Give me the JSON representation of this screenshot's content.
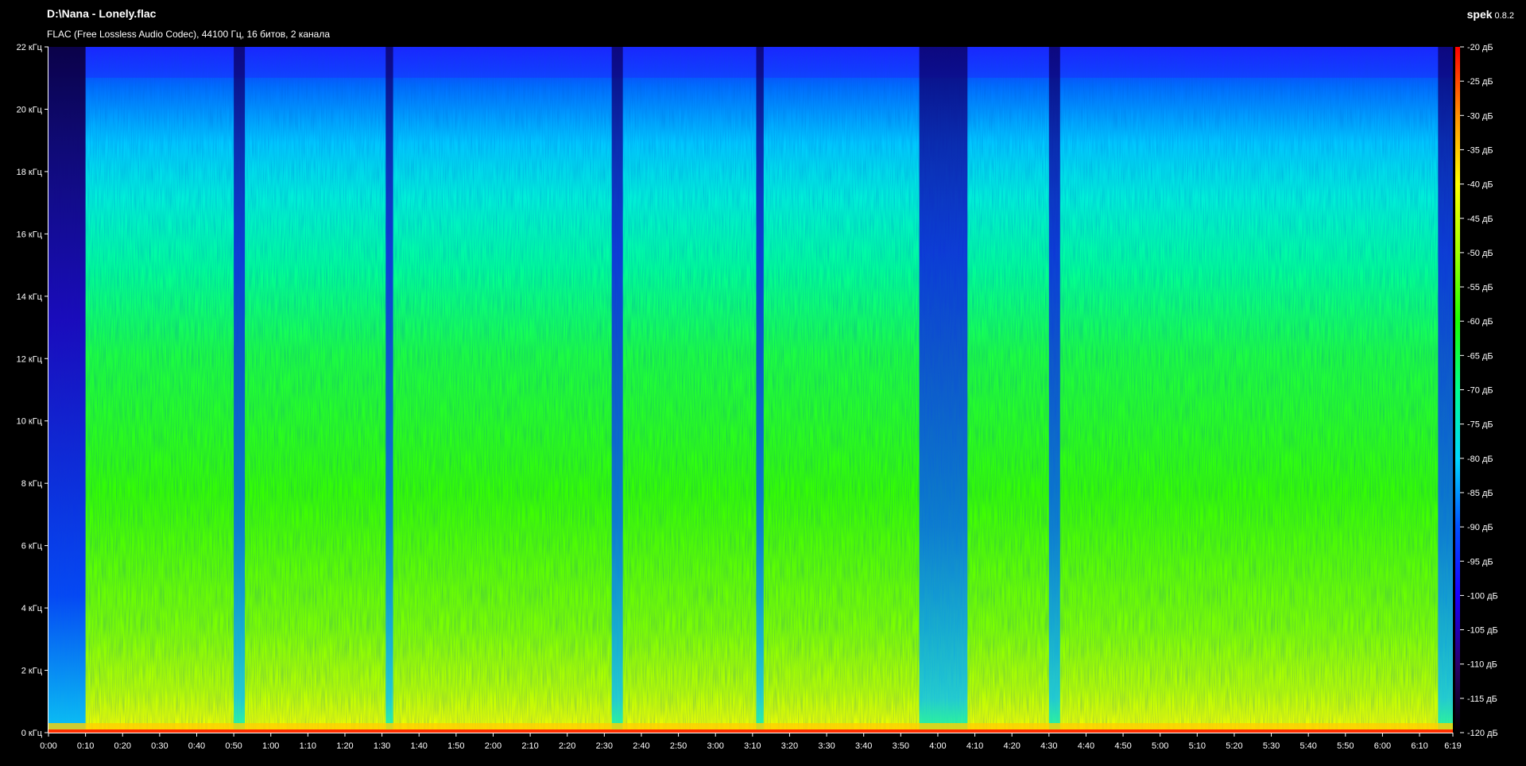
{
  "header": {
    "file_title": "D:\\Nana - Lonely.flac",
    "file_info": "FLAC (Free Lossless Audio Codec), 44100 Гц, 16 битов, 2 канала",
    "app_name": "spek",
    "app_version": "0.8.2"
  },
  "chart_data": {
    "type": "heatmap",
    "subtype": "spectrogram",
    "title": "D:\\Nana - Lonely.flac",
    "y_axis": {
      "unit": "кГц",
      "range": [
        0,
        22
      ],
      "ticks": [
        {
          "value": 0,
          "label": "0 кГц"
        },
        {
          "value": 2,
          "label": "2 кГц"
        },
        {
          "value": 4,
          "label": "4 кГц"
        },
        {
          "value": 6,
          "label": "6 кГц"
        },
        {
          "value": 8,
          "label": "8 кГц"
        },
        {
          "value": 10,
          "label": "10 кГц"
        },
        {
          "value": 12,
          "label": "12 кГц"
        },
        {
          "value": 14,
          "label": "14 кГц"
        },
        {
          "value": 16,
          "label": "16 кГц"
        },
        {
          "value": 18,
          "label": "18 кГц"
        },
        {
          "value": 20,
          "label": "20 кГц"
        },
        {
          "value": 22,
          "label": "22 кГц"
        }
      ]
    },
    "x_axis": {
      "unit": "time",
      "range_seconds": [
        0,
        379
      ],
      "ticks": [
        {
          "value": 0,
          "label": "0:00"
        },
        {
          "value": 10,
          "label": "0:10"
        },
        {
          "value": 20,
          "label": "0:20"
        },
        {
          "value": 30,
          "label": "0:30"
        },
        {
          "value": 40,
          "label": "0:40"
        },
        {
          "value": 50,
          "label": "0:50"
        },
        {
          "value": 60,
          "label": "1:00"
        },
        {
          "value": 70,
          "label": "1:10"
        },
        {
          "value": 80,
          "label": "1:20"
        },
        {
          "value": 90,
          "label": "1:30"
        },
        {
          "value": 100,
          "label": "1:40"
        },
        {
          "value": 110,
          "label": "1:50"
        },
        {
          "value": 120,
          "label": "2:00"
        },
        {
          "value": 130,
          "label": "2:10"
        },
        {
          "value": 140,
          "label": "2:20"
        },
        {
          "value": 150,
          "label": "2:30"
        },
        {
          "value": 160,
          "label": "2:40"
        },
        {
          "value": 170,
          "label": "2:50"
        },
        {
          "value": 180,
          "label": "3:00"
        },
        {
          "value": 190,
          "label": "3:10"
        },
        {
          "value": 200,
          "label": "3:20"
        },
        {
          "value": 210,
          "label": "3:30"
        },
        {
          "value": 220,
          "label": "3:40"
        },
        {
          "value": 230,
          "label": "3:50"
        },
        {
          "value": 240,
          "label": "4:00"
        },
        {
          "value": 250,
          "label": "4:10"
        },
        {
          "value": 260,
          "label": "4:20"
        },
        {
          "value": 270,
          "label": "4:30"
        },
        {
          "value": 280,
          "label": "4:40"
        },
        {
          "value": 290,
          "label": "4:50"
        },
        {
          "value": 300,
          "label": "5:00"
        },
        {
          "value": 310,
          "label": "5:10"
        },
        {
          "value": 320,
          "label": "5:20"
        },
        {
          "value": 330,
          "label": "5:30"
        },
        {
          "value": 340,
          "label": "5:40"
        },
        {
          "value": 350,
          "label": "5:50"
        },
        {
          "value": 360,
          "label": "6:00"
        },
        {
          "value": 370,
          "label": "6:10"
        },
        {
          "value": 379,
          "label": "6:19"
        }
      ]
    },
    "color_scale": {
      "unit": "дБ",
      "range": [
        -120,
        -20
      ],
      "ticks": [
        {
          "value": -20,
          "label": "-20 дБ"
        },
        {
          "value": -25,
          "label": "-25 дБ"
        },
        {
          "value": -30,
          "label": "-30 дБ"
        },
        {
          "value": -35,
          "label": "-35 дБ"
        },
        {
          "value": -40,
          "label": "-40 дБ"
        },
        {
          "value": -45,
          "label": "-45 дБ"
        },
        {
          "value": -50,
          "label": "-50 дБ"
        },
        {
          "value": -55,
          "label": "-55 дБ"
        },
        {
          "value": -60,
          "label": "-60 дБ"
        },
        {
          "value": -65,
          "label": "-65 дБ"
        },
        {
          "value": -70,
          "label": "-70 дБ"
        },
        {
          "value": -75,
          "label": "-75 дБ"
        },
        {
          "value": -80,
          "label": "-80 дБ"
        },
        {
          "value": -85,
          "label": "-85 дБ"
        },
        {
          "value": -90,
          "label": "-90 дБ"
        },
        {
          "value": -95,
          "label": "-95 дБ"
        },
        {
          "value": -100,
          "label": "-100 дБ"
        },
        {
          "value": -105,
          "label": "-105 дБ"
        },
        {
          "value": -110,
          "label": "-110 дБ"
        },
        {
          "value": -115,
          "label": "-115 дБ"
        },
        {
          "value": -120,
          "label": "-120 дБ"
        }
      ],
      "colors": [
        "#000000",
        "#2a006b",
        "#1a00ff",
        "#0050ff",
        "#00d8ff",
        "#00ff90",
        "#19ff00",
        "#a0ff00",
        "#ffff00",
        "#ff9000",
        "#ff0000"
      ]
    },
    "quiet_sections_seconds": [
      [
        0,
        10
      ],
      [
        50,
        53
      ],
      [
        91,
        93
      ],
      [
        152,
        155
      ],
      [
        191,
        193
      ],
      [
        235,
        248
      ],
      [
        270,
        273
      ],
      [
        375,
        379
      ]
    ],
    "grid": false,
    "legend": "right"
  }
}
